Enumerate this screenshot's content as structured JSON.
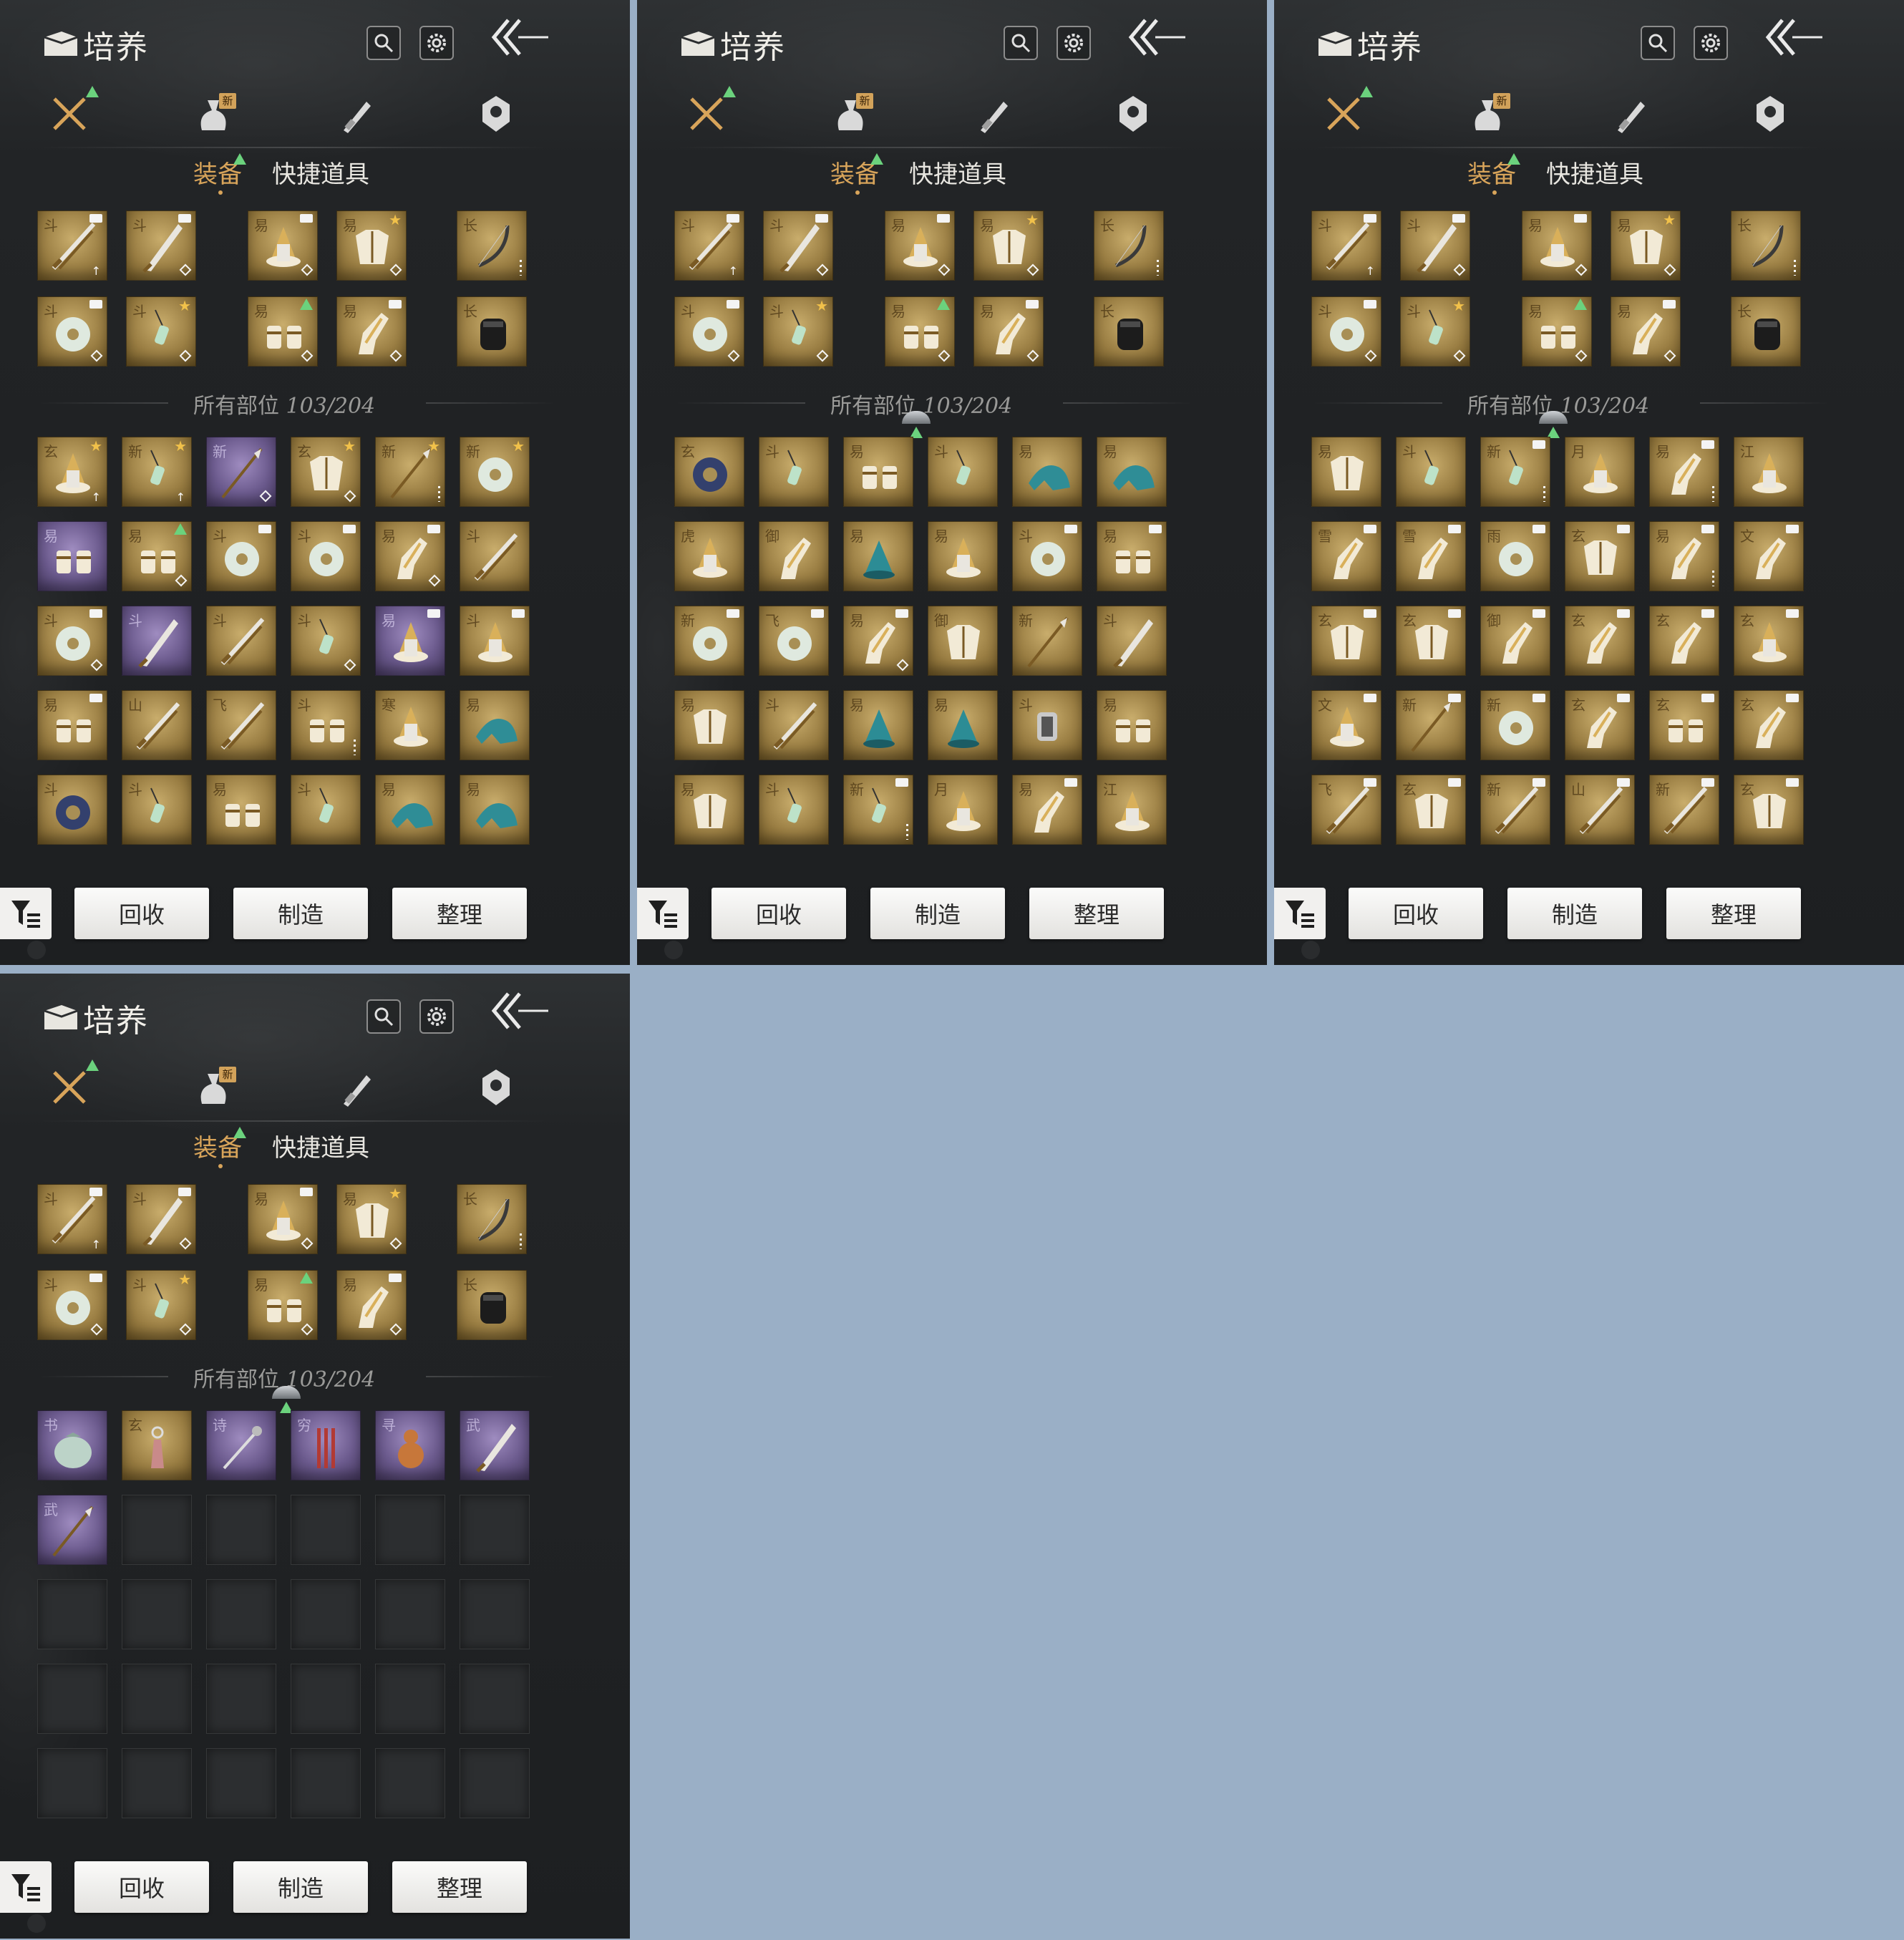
{
  "header": {
    "title": "培养",
    "new_badge": "新"
  },
  "category_tabs": [
    {
      "icon": "crossed-swords-icon",
      "badge": "up"
    },
    {
      "icon": "pouch-icon",
      "badge": "新"
    },
    {
      "icon": "scroll-icon",
      "badge": ""
    },
    {
      "icon": "badge-icon",
      "badge": ""
    }
  ],
  "sub_tabs": {
    "equipment": "装备",
    "quick_items": "快捷道具"
  },
  "inventory": {
    "label": "所有部位",
    "count": "103/204"
  },
  "actions": {
    "recycle": "回收",
    "craft": "制造",
    "sort": "整理"
  },
  "colors": {
    "gold_quality": "#b0924f",
    "purple_quality": "#7d6ba0",
    "accent": "#d8a45a",
    "upgrade": "#6bd27d"
  },
  "panels": [
    {
      "equipped": [
        [
          "斗",
          "sword-icon",
          "tag",
          "up"
        ],
        [
          "斗",
          "blade-icon",
          "tag",
          "diamond"
        ],
        [
          "易",
          "hat-icon",
          "tag",
          "diamond"
        ],
        [
          "易",
          "armor-icon",
          "star",
          "diamond"
        ],
        [
          "长",
          "bow-icon",
          "",
          "dots"
        ],
        [
          "斗",
          "jade-ring-icon",
          "tag",
          "diamond"
        ],
        [
          "斗",
          "pendant-icon",
          "star",
          "diamond"
        ],
        [
          "易",
          "bracer-icon",
          "up",
          "diamond"
        ],
        [
          "易",
          "boots-icon",
          "tag",
          "diamond"
        ],
        [
          "长",
          "quiver-icon",
          "",
          ""
        ]
      ],
      "items": [
        [
          "玄",
          "hat-icon",
          "star",
          "up",
          "g"
        ],
        [
          "新",
          "pendant-icon",
          "star",
          "up",
          "g"
        ],
        [
          "新",
          "spear-icon",
          "",
          "diamond",
          "p"
        ],
        [
          "玄",
          "armor-icon",
          "star",
          "diamond",
          "g"
        ],
        [
          "新",
          "spear-icon",
          "star",
          "dots",
          "g"
        ],
        [
          "新",
          "jade-ring-icon",
          "star",
          "",
          "g"
        ],
        [
          "易",
          "bracer-icon",
          "",
          "",
          "p"
        ],
        [
          "易",
          "bracer-icon",
          "up",
          "diamond",
          "g"
        ],
        [
          "斗",
          "jade-ring-icon",
          "tag",
          "",
          "g"
        ],
        [
          "斗",
          "jade-ring-icon",
          "tag",
          "",
          "g"
        ],
        [
          "易",
          "boots-icon",
          "tag",
          "diamond",
          "g"
        ],
        [
          "斗",
          "sword-icon",
          "",
          "",
          "g"
        ],
        [
          "斗",
          "jade-ring-icon",
          "tag",
          "diamond",
          "g"
        ],
        [
          "斗",
          "blade-icon",
          "",
          "",
          "p"
        ],
        [
          "斗",
          "sword-icon",
          "",
          "",
          "g"
        ],
        [
          "斗",
          "pendant-icon",
          "",
          "diamond",
          "g"
        ],
        [
          "易",
          "hat-icon",
          "tag",
          "",
          "p"
        ],
        [
          "斗",
          "hat-icon",
          "tag",
          "",
          "g"
        ],
        [
          "易",
          "bracer-icon",
          "tag",
          "",
          "g"
        ],
        [
          "山",
          "sword-icon",
          "",
          "",
          "g"
        ],
        [
          "飞",
          "sword-icon",
          "",
          "",
          "g"
        ],
        [
          "斗",
          "bracer-icon",
          "",
          "dots",
          "g"
        ],
        [
          "寒",
          "hat-icon",
          "",
          "",
          "g"
        ],
        [
          "易",
          "cloak-icon",
          "",
          "",
          "g"
        ],
        [
          "斗",
          "ring-icon",
          "",
          "",
          "g"
        ],
        [
          "斗",
          "pendant-icon",
          "",
          "",
          "g"
        ],
        [
          "易",
          "bracer-icon",
          "",
          "",
          "g"
        ],
        [
          "斗",
          "pendant-icon",
          "",
          "",
          "g"
        ],
        [
          "易",
          "cloak-icon",
          "",
          "",
          "g"
        ],
        [
          "易",
          "cloak-icon",
          "",
          "",
          "g"
        ]
      ]
    },
    {
      "equipped": [
        [
          "斗",
          "sword-icon",
          "tag",
          "up"
        ],
        [
          "斗",
          "blade-icon",
          "tag",
          "diamond"
        ],
        [
          "易",
          "hat-icon",
          "tag",
          "diamond"
        ],
        [
          "易",
          "armor-icon",
          "star",
          "diamond"
        ],
        [
          "长",
          "bow-icon",
          "",
          "dots"
        ],
        [
          "斗",
          "jade-ring-icon",
          "tag",
          "diamond"
        ],
        [
          "斗",
          "pendant-icon",
          "star",
          "diamond"
        ],
        [
          "易",
          "bracer-icon",
          "up",
          "diamond"
        ],
        [
          "易",
          "boots-icon",
          "tag",
          "diamond"
        ],
        [
          "长",
          "quiver-icon",
          "",
          ""
        ]
      ],
      "items": [
        [
          "玄",
          "ring-icon",
          "",
          "",
          "g"
        ],
        [
          "斗",
          "pendant-icon",
          "",
          "",
          "g"
        ],
        [
          "易",
          "bracer-icon",
          "",
          "",
          "g"
        ],
        [
          "斗",
          "pendant-icon",
          "",
          "",
          "g"
        ],
        [
          "易",
          "cloak-icon",
          "",
          "",
          "g"
        ],
        [
          "易",
          "cloak-icon",
          "",
          "",
          "g"
        ],
        [
          "虎",
          "hat-icon",
          "",
          "",
          "g"
        ],
        [
          "御",
          "boots-icon",
          "",
          "",
          "g"
        ],
        [
          "易",
          "hood-icon",
          "",
          "",
          "g"
        ],
        [
          "易",
          "hat-icon",
          "",
          "",
          "g"
        ],
        [
          "斗",
          "jade-ring-icon",
          "tag",
          "",
          "g"
        ],
        [
          "易",
          "bracer-icon",
          "tag",
          "",
          "g"
        ],
        [
          "新",
          "jade-ring-icon",
          "tag",
          "",
          "g"
        ],
        [
          "飞",
          "jade-ring-icon",
          "tag",
          "",
          "g"
        ],
        [
          "易",
          "boots-icon",
          "tag",
          "diamond",
          "g"
        ],
        [
          "御",
          "armor-icon",
          "",
          "",
          "g"
        ],
        [
          "新",
          "spear-icon",
          "",
          "",
          "g"
        ],
        [
          "斗",
          "blade-icon",
          "",
          "",
          "g"
        ],
        [
          "易",
          "armor-icon",
          "",
          "",
          "g"
        ],
        [
          "斗",
          "sword-icon",
          "",
          "",
          "g"
        ],
        [
          "易",
          "hood-icon",
          "",
          "",
          "g"
        ],
        [
          "易",
          "hood-icon",
          "",
          "",
          "g"
        ],
        [
          "斗",
          "gauntlet-icon",
          "",
          "",
          "g"
        ],
        [
          "易",
          "bracer-icon",
          "",
          "",
          "g"
        ],
        [
          "易",
          "armor-icon",
          "",
          "",
          "g"
        ],
        [
          "斗",
          "pendant-icon",
          "",
          "",
          "g"
        ],
        [
          "新",
          "pendant-icon",
          "tag",
          "dots",
          "g"
        ],
        [
          "月",
          "hat-icon",
          "",
          "",
          "g"
        ],
        [
          "易",
          "boots-icon",
          "tag",
          "",
          "g"
        ],
        [
          "江",
          "hat-icon",
          "",
          "",
          "g"
        ]
      ]
    },
    {
      "equipped": [
        [
          "斗",
          "sword-icon",
          "tag",
          "up"
        ],
        [
          "斗",
          "blade-icon",
          "tag",
          "diamond"
        ],
        [
          "易",
          "hat-icon",
          "tag",
          "diamond"
        ],
        [
          "易",
          "armor-icon",
          "star",
          "diamond"
        ],
        [
          "长",
          "bow-icon",
          "",
          "dots"
        ],
        [
          "斗",
          "jade-ring-icon",
          "tag",
          "diamond"
        ],
        [
          "斗",
          "pendant-icon",
          "star",
          "diamond"
        ],
        [
          "易",
          "bracer-icon",
          "up",
          "diamond"
        ],
        [
          "易",
          "boots-icon",
          "tag",
          "diamond"
        ],
        [
          "长",
          "quiver-icon",
          "",
          ""
        ]
      ],
      "items": [
        [
          "易",
          "armor-icon",
          "",
          "",
          "g"
        ],
        [
          "斗",
          "pendant-icon",
          "",
          "",
          "g"
        ],
        [
          "新",
          "pendant-icon",
          "tag",
          "dots",
          "g"
        ],
        [
          "月",
          "hat-icon",
          "",
          "",
          "g"
        ],
        [
          "易",
          "boots-icon",
          "tag",
          "dots",
          "g"
        ],
        [
          "江",
          "hat-icon",
          "",
          "",
          "g"
        ],
        [
          "雪",
          "boots-icon",
          "tag",
          "",
          "g"
        ],
        [
          "雪",
          "boots-icon",
          "tag",
          "",
          "g"
        ],
        [
          "雨",
          "jade-ring-icon",
          "tag",
          "",
          "g"
        ],
        [
          "玄",
          "armor-icon",
          "tag",
          "",
          "g"
        ],
        [
          "易",
          "boots-icon",
          "tag",
          "dots",
          "g"
        ],
        [
          "文",
          "boots-icon",
          "tag",
          "",
          "g"
        ],
        [
          "玄",
          "armor-icon",
          "tag",
          "",
          "g"
        ],
        [
          "玄",
          "armor-icon",
          "tag",
          "",
          "g"
        ],
        [
          "御",
          "boots-icon",
          "tag",
          "",
          "g"
        ],
        [
          "玄",
          "boots-icon",
          "tag",
          "",
          "g"
        ],
        [
          "玄",
          "boots-icon",
          "tag",
          "",
          "g"
        ],
        [
          "玄",
          "hat-icon",
          "tag",
          "",
          "g"
        ],
        [
          "文",
          "hat-icon",
          "tag",
          "",
          "g"
        ],
        [
          "新",
          "spear-icon",
          "tag",
          "",
          "g"
        ],
        [
          "新",
          "jade-ring-icon",
          "tag",
          "",
          "g"
        ],
        [
          "玄",
          "boots-icon",
          "tag",
          "",
          "g"
        ],
        [
          "玄",
          "bracer-icon",
          "tag",
          "",
          "g"
        ],
        [
          "玄",
          "boots-icon",
          "tag",
          "",
          "g"
        ],
        [
          "飞",
          "sword-icon",
          "tag",
          "",
          "g"
        ],
        [
          "玄",
          "armor-icon",
          "tag",
          "",
          "g"
        ],
        [
          "新",
          "sword-icon",
          "tag",
          "",
          "g"
        ],
        [
          "山",
          "sword-icon",
          "tag",
          "",
          "g"
        ],
        [
          "新",
          "sword-icon",
          "tag",
          "",
          "g"
        ],
        [
          "玄",
          "armor-icon",
          "tag",
          "",
          "g"
        ]
      ]
    },
    {
      "equipped": [
        [
          "斗",
          "sword-icon",
          "tag",
          "up"
        ],
        [
          "斗",
          "blade-icon",
          "tag",
          "diamond"
        ],
        [
          "易",
          "hat-icon",
          "tag",
          "diamond"
        ],
        [
          "易",
          "armor-icon",
          "star",
          "diamond"
        ],
        [
          "长",
          "bow-icon",
          "",
          "dots"
        ],
        [
          "斗",
          "jade-ring-icon",
          "tag",
          "diamond"
        ],
        [
          "斗",
          "pendant-icon",
          "star",
          "diamond"
        ],
        [
          "易",
          "bracer-icon",
          "up",
          "diamond"
        ],
        [
          "易",
          "boots-icon",
          "tag",
          "diamond"
        ],
        [
          "长",
          "quiver-icon",
          "",
          ""
        ]
      ],
      "items": [
        [
          "书",
          "pouch-icon",
          "",
          "",
          "p"
        ],
        [
          "玄",
          "tassel-icon",
          "",
          "",
          "g"
        ],
        [
          "诗",
          "hairpin-icon",
          "",
          "",
          "p"
        ],
        [
          "穷",
          "incense-icon",
          "",
          "",
          "p"
        ],
        [
          "寻",
          "gourd-icon",
          "",
          "",
          "p"
        ],
        [
          "武",
          "blade-icon",
          "",
          "",
          "p"
        ],
        [
          "武",
          "spear-icon",
          "",
          "",
          "p"
        ],
        [
          "",
          "",
          "",
          "",
          "e"
        ],
        [
          "",
          "",
          "",
          "",
          "e"
        ],
        [
          "",
          "",
          "",
          "",
          "e"
        ],
        [
          "",
          "",
          "",
          "",
          "e"
        ],
        [
          "",
          "",
          "",
          "",
          "e"
        ],
        [
          "",
          "",
          "",
          "",
          "e"
        ],
        [
          "",
          "",
          "",
          "",
          "e"
        ],
        [
          "",
          "",
          "",
          "",
          "e"
        ],
        [
          "",
          "",
          "",
          "",
          "e"
        ],
        [
          "",
          "",
          "",
          "",
          "e"
        ],
        [
          "",
          "",
          "",
          "",
          "e"
        ],
        [
          "",
          "",
          "",
          "",
          "e"
        ],
        [
          "",
          "",
          "",
          "",
          "e"
        ],
        [
          "",
          "",
          "",
          "",
          "e"
        ],
        [
          "",
          "",
          "",
          "",
          "e"
        ],
        [
          "",
          "",
          "",
          "",
          "e"
        ],
        [
          "",
          "",
          "",
          "",
          "e"
        ],
        [
          "",
          "",
          "",
          "",
          "e"
        ],
        [
          "",
          "",
          "",
          "",
          "e"
        ],
        [
          "",
          "",
          "",
          "",
          "e"
        ],
        [
          "",
          "",
          "",
          "",
          "e"
        ],
        [
          "",
          "",
          "",
          "",
          "e"
        ],
        [
          "",
          "",
          "",
          "",
          "e"
        ]
      ]
    }
  ]
}
